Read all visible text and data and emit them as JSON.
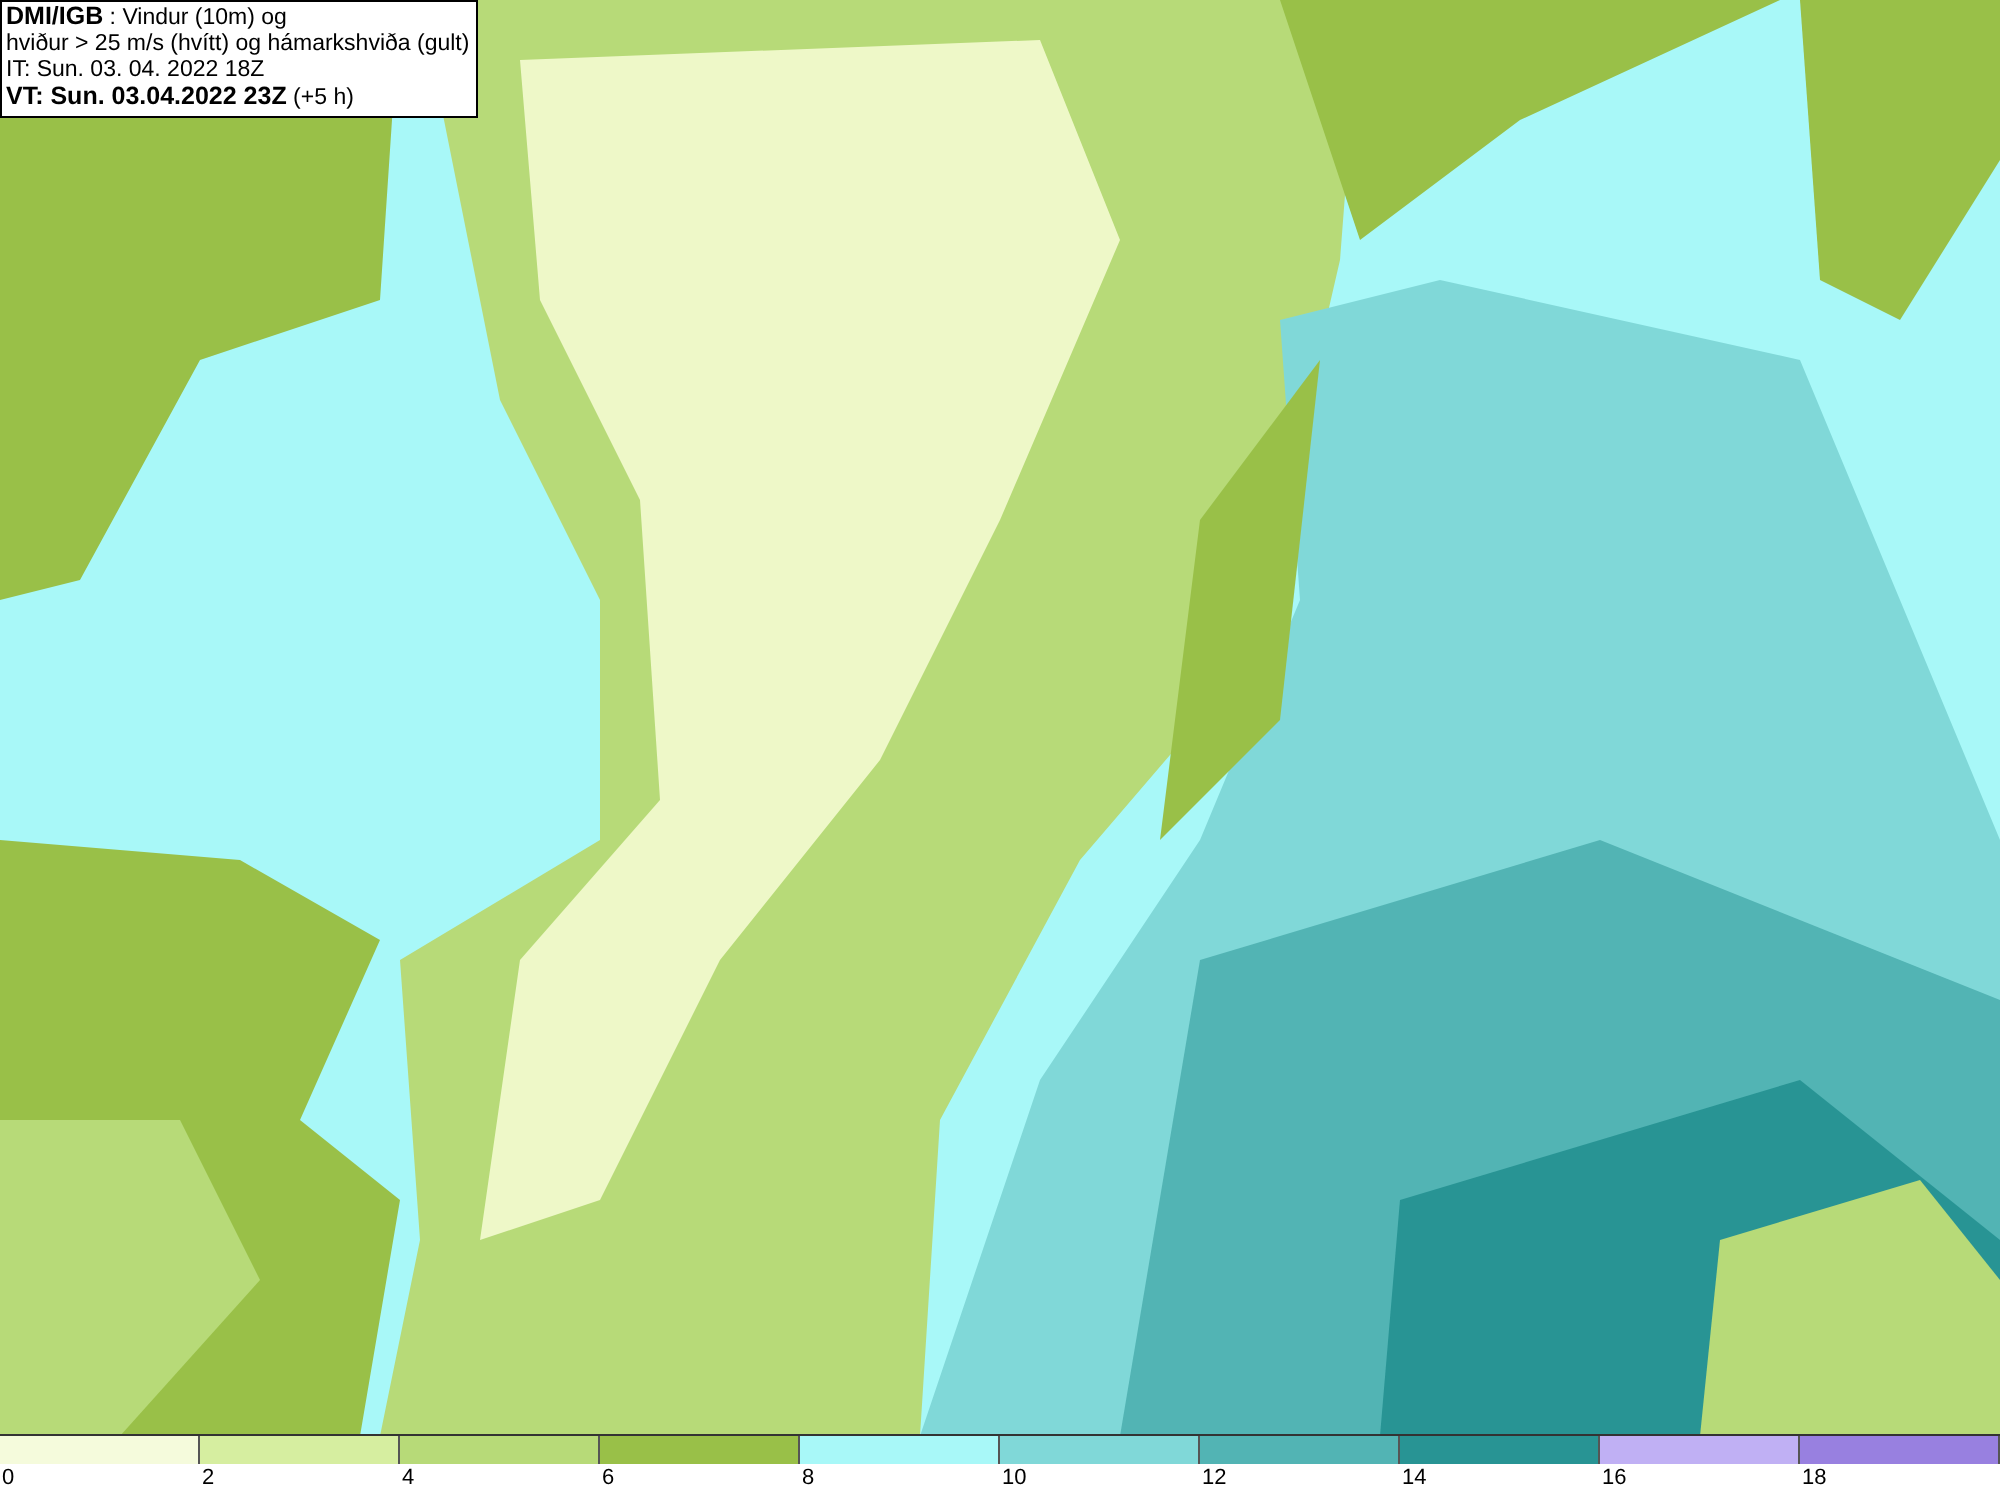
{
  "legend": {
    "lines": [
      "**DMI/IGB** : Vindur (10m) og",
      "hviður > 25 m/s (hvítt) og hámarkshviða (gult)",
      "IT: Sun. 03. 04. 2022 18Z",
      "**VT: Sun. 03.04.2022 23Z** (+5 h)"
    ]
  },
  "colorbar": [
    {
      "color": "#f5fbdc",
      "label": "0"
    },
    {
      "color": "#d6eea0",
      "label": "2"
    },
    {
      "color": "#b7da78",
      "label": "4"
    },
    {
      "color": "#99c048",
      "label": "6"
    },
    {
      "color": "#a8f8f8",
      "label": "8"
    },
    {
      "color": "#80d8d8",
      "label": "10"
    },
    {
      "color": "#52b4b4",
      "label": "12"
    },
    {
      "color": "#289494",
      "label": "14"
    },
    {
      "color": "#c0b0f4",
      "label": "16"
    },
    {
      "color": "#9880e0",
      "label": "18"
    }
  ]
}
